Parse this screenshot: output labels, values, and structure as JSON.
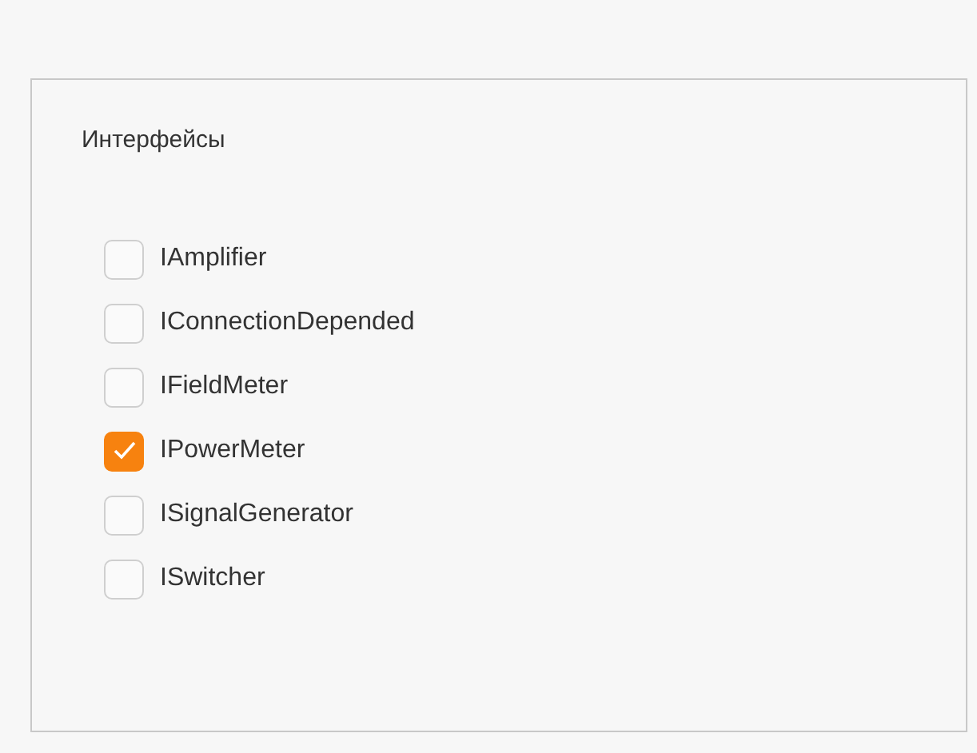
{
  "panel": {
    "title": "Интерфейсы",
    "items": [
      {
        "label": "IAmplifier",
        "checked": false
      },
      {
        "label": "IConnectionDepended",
        "checked": false
      },
      {
        "label": "IFieldMeter",
        "checked": false
      },
      {
        "label": "IPowerMeter",
        "checked": true
      },
      {
        "label": "ISignalGenerator",
        "checked": false
      },
      {
        "label": "ISwitcher",
        "checked": false
      }
    ]
  }
}
